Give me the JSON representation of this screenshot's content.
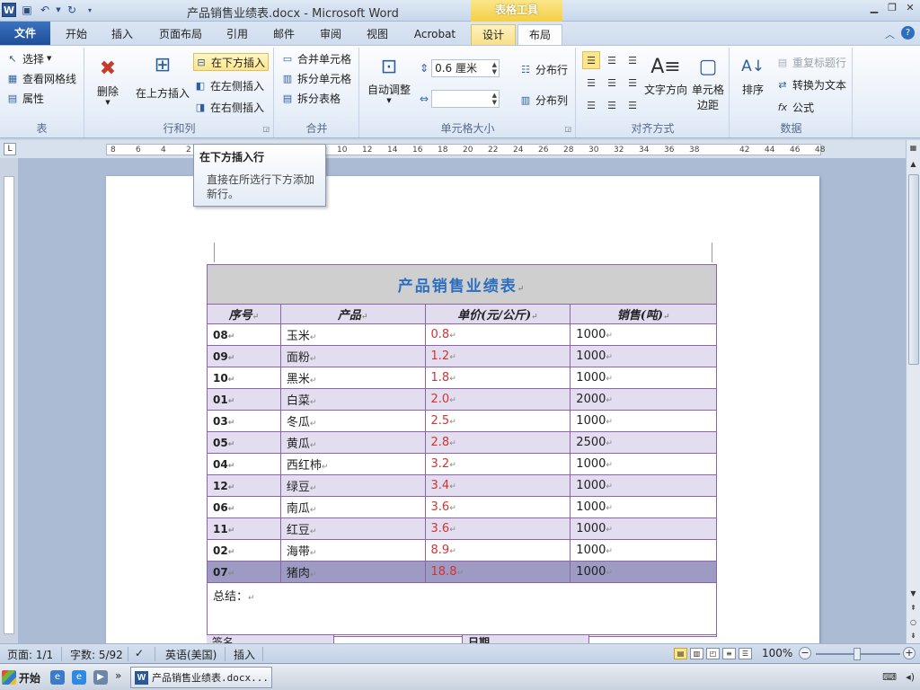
{
  "titlebar": {
    "doc_title": "产品销售业绩表.docx - Microsoft Word",
    "context_tab_title": "表格工具",
    "word_logo": "W"
  },
  "tabs": [
    {
      "label": "文件"
    },
    {
      "label": "开始"
    },
    {
      "label": "插入"
    },
    {
      "label": "页面布局"
    },
    {
      "label": "引用"
    },
    {
      "label": "邮件"
    },
    {
      "label": "审阅"
    },
    {
      "label": "视图"
    },
    {
      "label": "Acrobat"
    },
    {
      "label": "设计"
    },
    {
      "label": "布局"
    }
  ],
  "ribbon": {
    "table_group": {
      "label": "表",
      "select": "选择",
      "gridlines": "查看网格线",
      "properties": "属性"
    },
    "rows_cols_group": {
      "label": "行和列",
      "delete": "删除",
      "insert_above": "在上方插入",
      "insert_below": "在下方插入",
      "insert_left": "在左侧插入",
      "insert_right": "在右侧插入"
    },
    "merge_group": {
      "label": "合并",
      "merge_cells": "合并单元格",
      "split_cells": "拆分单元格",
      "split_table": "拆分表格"
    },
    "cell_size_group": {
      "label": "单元格大小",
      "autofit": "自动调整",
      "height_value": "0.6 厘米",
      "width_value": "",
      "distribute_rows": "分布行",
      "distribute_cols": "分布列"
    },
    "alignment_group": {
      "label": "对齐方式",
      "text_direction": "文字方向",
      "cell_margins_1": "单元格",
      "cell_margins_2": "边距"
    },
    "data_group": {
      "label": "数据",
      "sort": "排序",
      "repeat_header": "重复标题行",
      "convert_text": "转换为文本",
      "formula": "公式"
    }
  },
  "tooltip": {
    "title": "在下方插入行",
    "desc_line1": "直接在所选行下方添加",
    "desc_line2": "新行。"
  },
  "ruler": {
    "h_numbers": [
      "8",
      "6",
      "4",
      "2",
      "",
      "",
      "",
      "",
      "",
      "10",
      "12",
      "14",
      "16",
      "18",
      "20",
      "22",
      "24",
      "26",
      "28",
      "30",
      "32",
      "34",
      "36",
      "38",
      "",
      "42",
      "44",
      "46",
      "48"
    ]
  },
  "document": {
    "table_title": "产品销售业绩表",
    "headers": [
      "序号",
      "产品",
      "单价(元/公斤)",
      "销售(吨)"
    ],
    "rows": [
      {
        "id": "08",
        "product": "玉米",
        "price": "0.8",
        "qty": "1000"
      },
      {
        "id": "09",
        "product": "面粉",
        "price": "1.2",
        "qty": "1000"
      },
      {
        "id": "10",
        "product": "黑米",
        "price": "1.8",
        "qty": "1000"
      },
      {
        "id": "01",
        "product": "白菜",
        "price": "2.0",
        "qty": "2000"
      },
      {
        "id": "03",
        "product": "冬瓜",
        "price": "2.5",
        "qty": "1000"
      },
      {
        "id": "05",
        "product": "黄瓜",
        "price": "2.8",
        "qty": "2500"
      },
      {
        "id": "04",
        "product": "西红柿",
        "price": "3.2",
        "qty": "1000"
      },
      {
        "id": "12",
        "product": "绿豆",
        "price": "3.4",
        "qty": "1000"
      },
      {
        "id": "06",
        "product": "南瓜",
        "price": "3.6",
        "qty": "1000"
      },
      {
        "id": "11",
        "product": "红豆",
        "price": "3.6",
        "qty": "1000"
      },
      {
        "id": "02",
        "product": "海带",
        "price": "8.9",
        "qty": "1000"
      },
      {
        "id": "07",
        "product": "猪肉",
        "price": "18.8",
        "qty": "1000"
      }
    ],
    "summary_label": "总结：",
    "sign_label": "签名",
    "date_label": "日期"
  },
  "statusbar": {
    "page": "页面: 1/1",
    "words": "字数: 5/92",
    "language": "英语(美国)",
    "mode": "插入",
    "zoom": "100%"
  },
  "taskbar": {
    "start": "开始",
    "task_label": "产品销售业绩表.docx..."
  },
  "colors": {
    "title_text": "#2d6fbf",
    "price_text": "#d23333",
    "table_border": "#8e64a6",
    "selected_row": "#9d9bc3"
  }
}
